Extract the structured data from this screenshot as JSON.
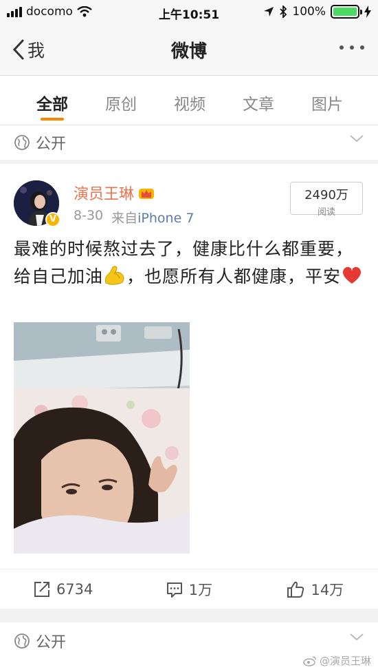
{
  "status_bar": {
    "carrier": "docomo",
    "time": "上午10:51",
    "battery": "100%"
  },
  "nav": {
    "back_label": "我",
    "title": "微博"
  },
  "tabs": [
    {
      "label": "全部",
      "active": true
    },
    {
      "label": "原创",
      "active": false
    },
    {
      "label": "视频",
      "active": false
    },
    {
      "label": "文章",
      "active": false
    },
    {
      "label": "图片",
      "active": false
    }
  ],
  "visibility": {
    "top_label": "公开",
    "bottom_label": "公开"
  },
  "post": {
    "author": "演员王琳",
    "date": "8-30",
    "source_prefix": "来自",
    "source_device": "iPhone 7",
    "reads_count": "2490万",
    "reads_label": "阅读",
    "text_part1": "最难的时候熬过去了，健康比什么都重要，给自己加油",
    "text_part2": "，也愿所有人都健康，平安",
    "reposts": "6734",
    "comments": "1万",
    "likes": "14万"
  },
  "watermark": "@演员王琳",
  "colors": {
    "accent": "#ff8200",
    "author_name": "#eb7350",
    "source_link": "#5b7ca8",
    "battery_fill": "#4cd964"
  }
}
